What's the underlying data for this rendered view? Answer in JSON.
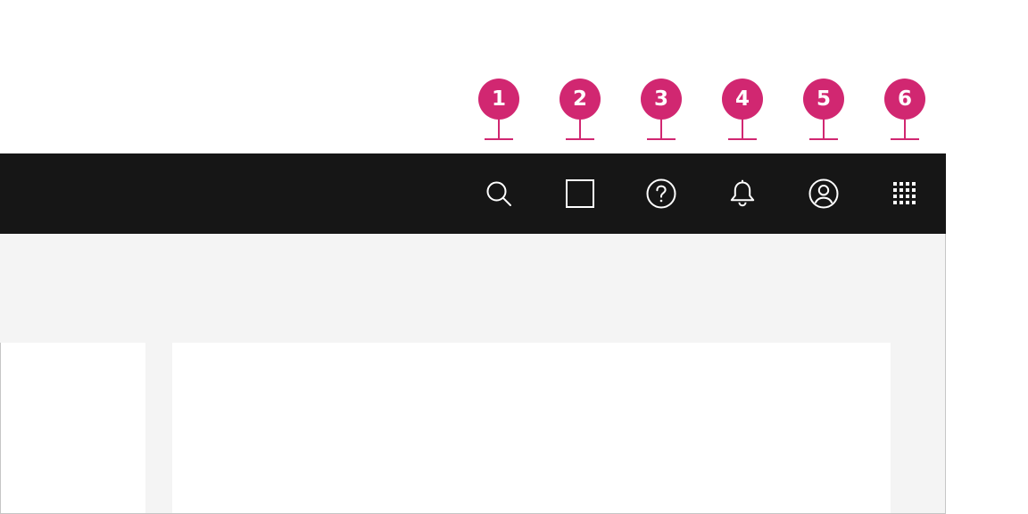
{
  "colors": {
    "marker": "#d12771",
    "header_bg": "#161616",
    "icon": "#ffffff",
    "content_bg": "#f4f4f4",
    "panel_bg": "#ffffff"
  },
  "markers": [
    {
      "label": "1"
    },
    {
      "label": "2"
    },
    {
      "label": "3"
    },
    {
      "label": "4"
    },
    {
      "label": "5"
    },
    {
      "label": "6"
    }
  ],
  "header": {
    "actions": [
      {
        "icon": "search-icon"
      },
      {
        "icon": "square-icon"
      },
      {
        "icon": "help-icon"
      },
      {
        "icon": "bell-icon"
      },
      {
        "icon": "user-avatar-icon"
      },
      {
        "icon": "app-switcher-icon"
      }
    ]
  }
}
